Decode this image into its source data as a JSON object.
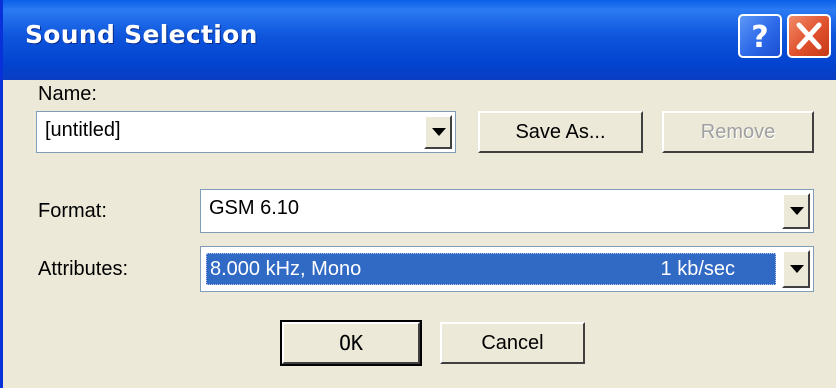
{
  "window": {
    "title": "Sound Selection",
    "help_button": "?",
    "close_button": "close"
  },
  "name": {
    "label": "Name:",
    "value": "[untitled]",
    "save_as_label": "Save As...",
    "remove_label": "Remove"
  },
  "format": {
    "label": "Format:",
    "value": "GSM 6.10"
  },
  "attributes": {
    "label": "Attributes:",
    "value_left": "8.000 kHz, Mono",
    "value_right": "1 kb/sec"
  },
  "buttons": {
    "ok_label": "OK",
    "cancel_label": "Cancel"
  },
  "icons": {
    "help": "question-mark-icon",
    "close": "close-x-icon",
    "dropdown": "chevron-down-icon"
  },
  "colors": {
    "titlebar": "#0343d0",
    "dialog_bg": "#ece9d8",
    "selection": "#316ac5",
    "close_button": "#e0502c"
  }
}
